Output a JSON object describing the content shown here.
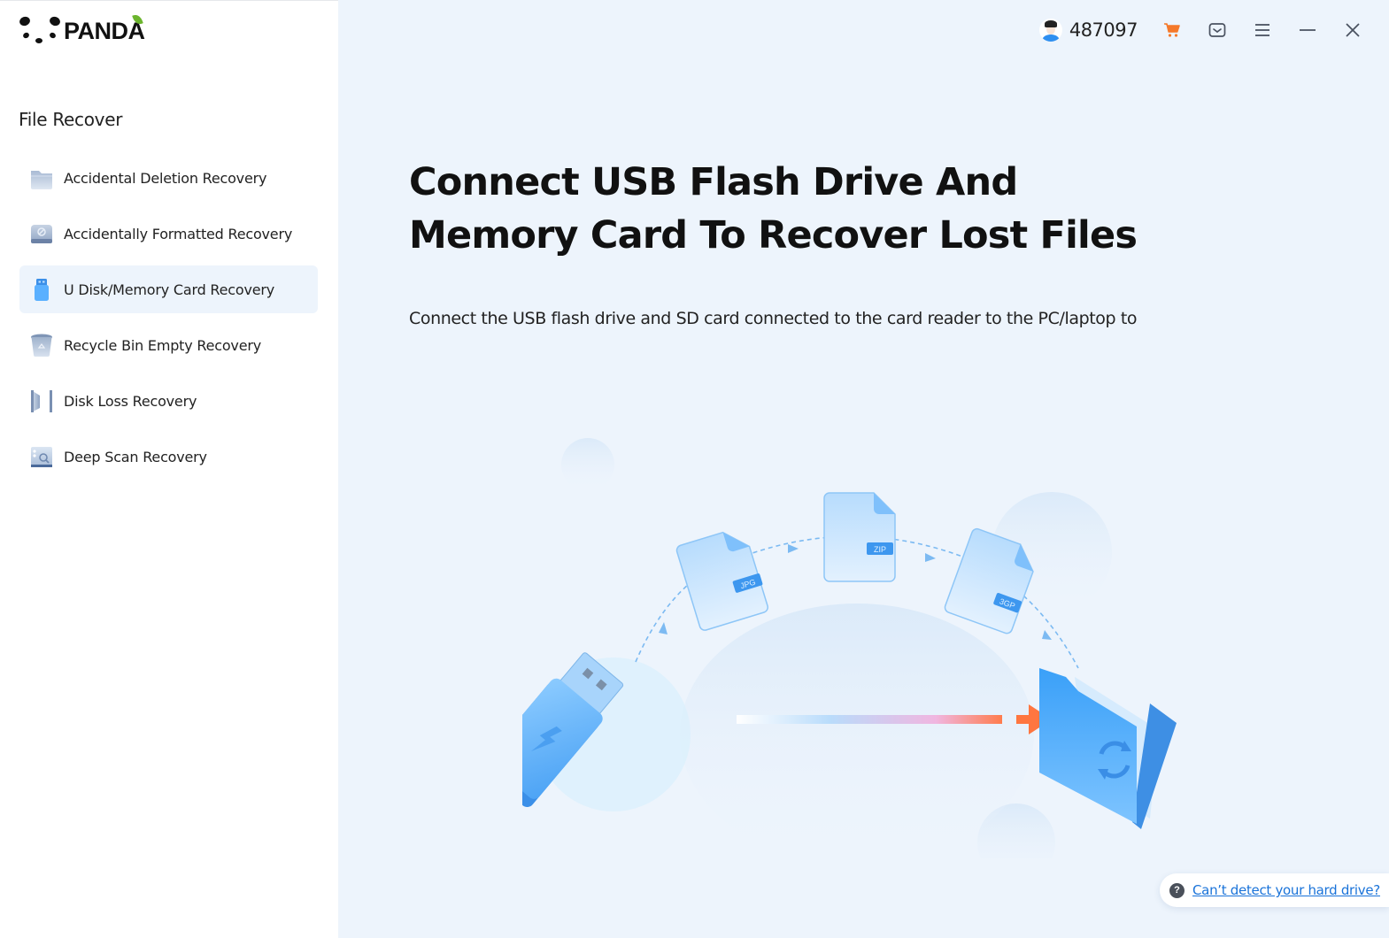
{
  "app": {
    "logo_text": "PANDA"
  },
  "sidebar": {
    "section_title": "File Recover",
    "items": [
      {
        "label": "Accidental Deletion Recovery",
        "icon": "folder-icon",
        "active": false
      },
      {
        "label": "Accidentally Formatted Recovery",
        "icon": "formatted-drive-icon",
        "active": false
      },
      {
        "label": "U Disk/Memory Card Recovery",
        "icon": "usb-drive-icon",
        "active": true
      },
      {
        "label": "Recycle Bin Empty Recovery",
        "icon": "recycle-bin-icon",
        "active": false
      },
      {
        "label": "Disk Loss Recovery",
        "icon": "disk-loss-icon",
        "active": false
      },
      {
        "label": "Deep Scan Recovery",
        "icon": "deep-scan-icon",
        "active": false
      }
    ]
  },
  "topbar": {
    "user_id": "487097",
    "icons": [
      "avatar",
      "cart-icon",
      "message-icon",
      "menu-icon",
      "minimize-icon",
      "close-icon"
    ],
    "accent_color": "#f5792a"
  },
  "main": {
    "headline": "Connect USB Flash Drive And Memory Card To Recover Lost Files",
    "description": "Connect the USB flash drive and SD card connected to the card reader to the PC/laptop to",
    "illustration": {
      "file_tags": [
        "JPG",
        "ZIP",
        "3GP"
      ]
    }
  },
  "help": {
    "icon_glyph": "?",
    "link_text": "Can’t detect your hard drive?"
  }
}
